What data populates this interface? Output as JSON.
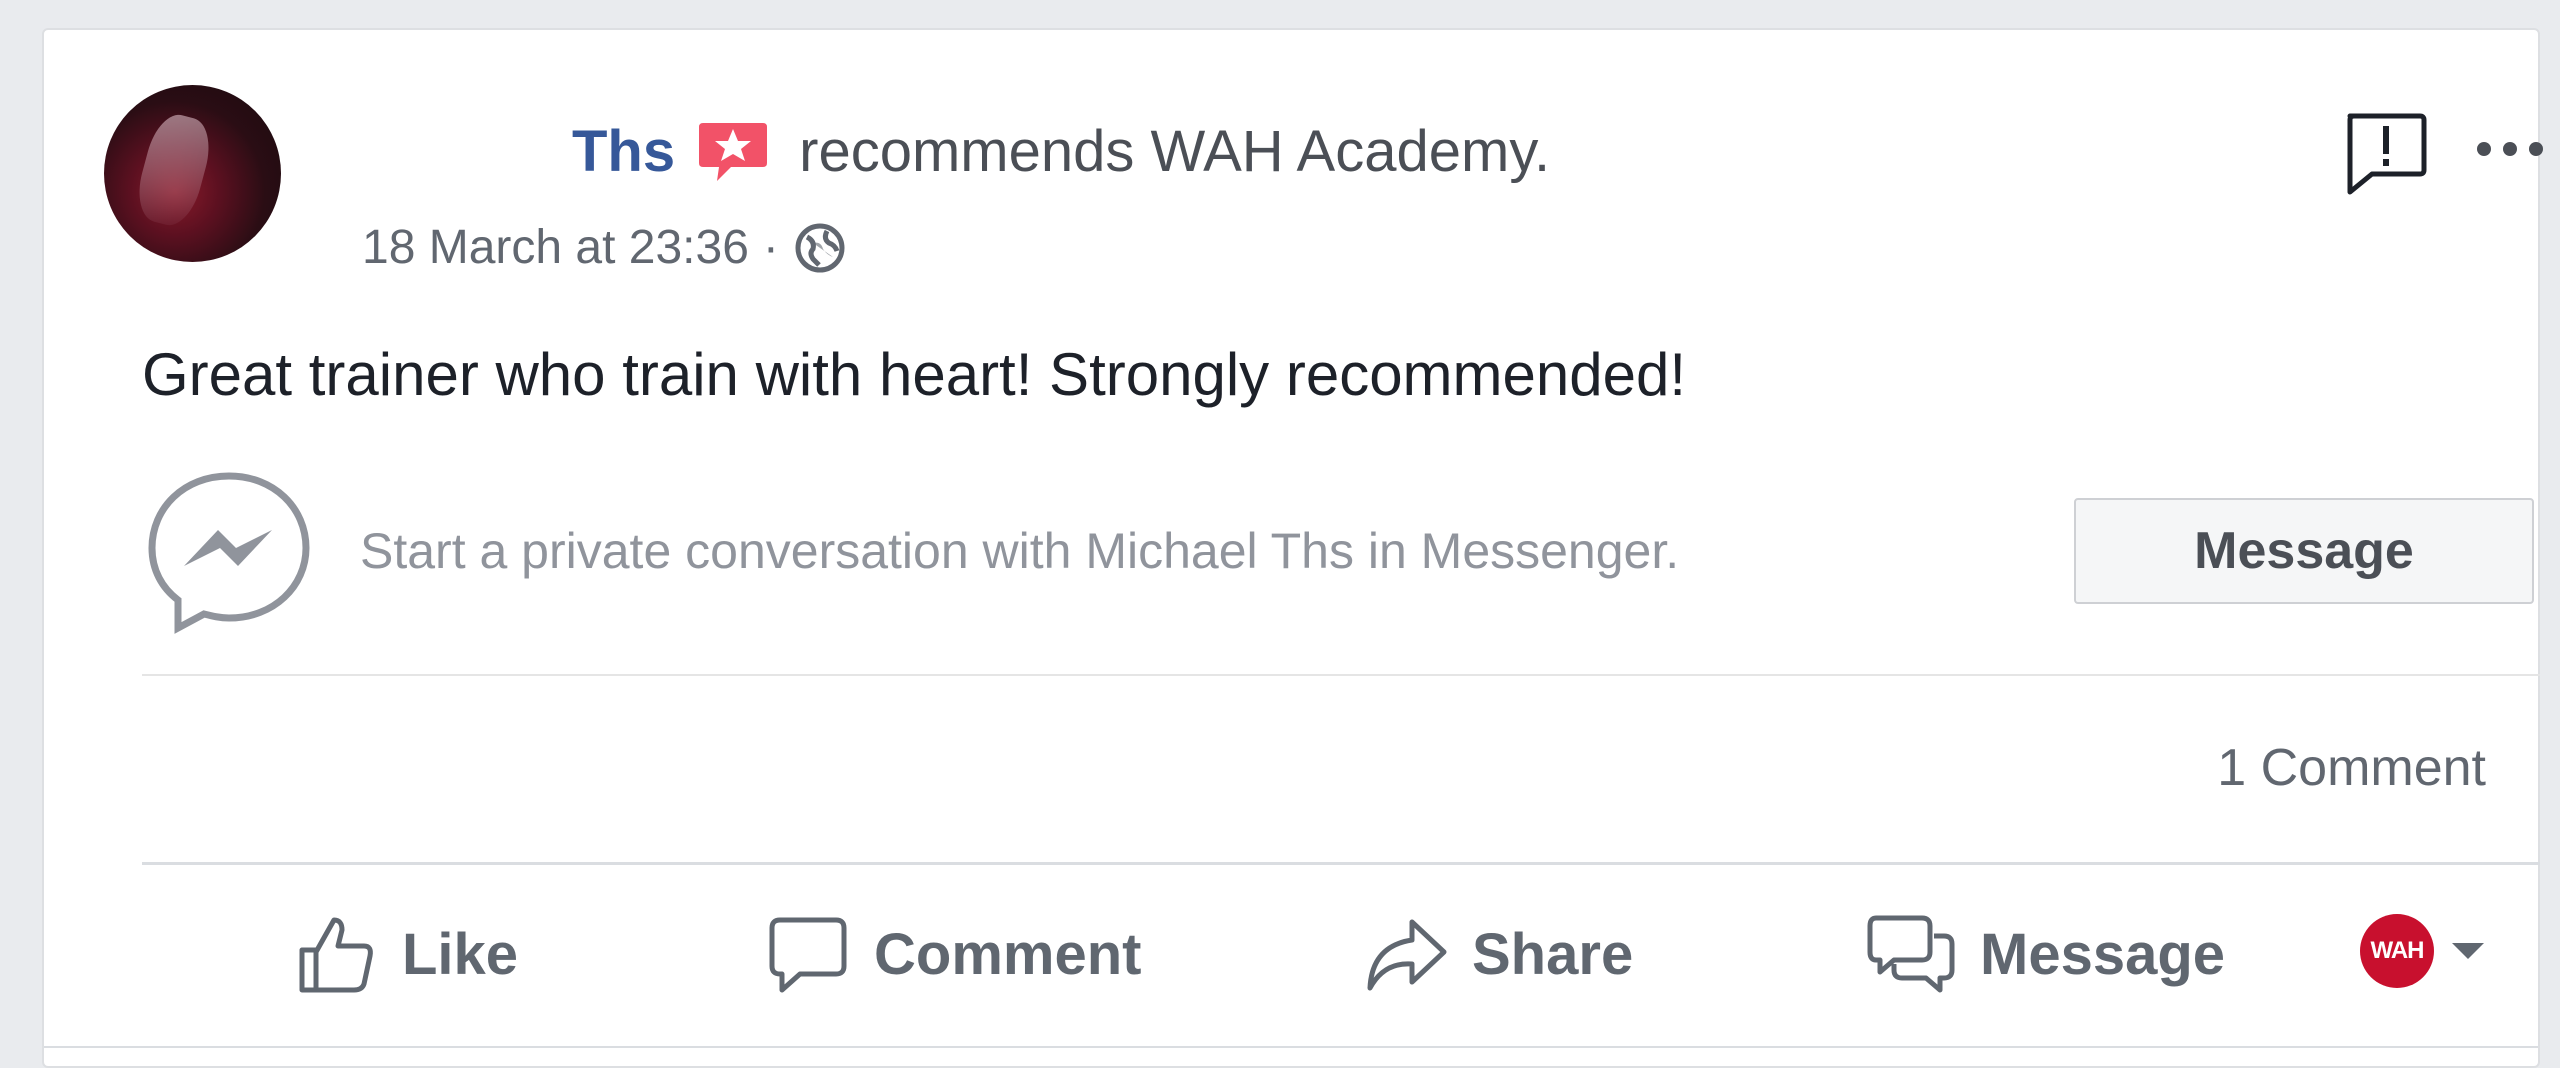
{
  "post": {
    "author": "Ths",
    "recommend_text": "recommends",
    "page_name": "WAH Academy.",
    "timestamp": "18 March at 23:36",
    "separator": "·",
    "body": "Great trainer who train with heart! Strongly recommended!"
  },
  "messenger_prompt": {
    "text": "Start a private conversation with Michael Ths in Messenger.",
    "button_label": "Message"
  },
  "stats": {
    "comments": "1 Comment"
  },
  "actions": {
    "like": "Like",
    "comment": "Comment",
    "share": "Share",
    "message": "Message"
  },
  "page_selector": {
    "logo_text": "WAH"
  },
  "colors": {
    "author_link": "#365899",
    "recommend_badge": "#f25268",
    "action_text": "#606770"
  }
}
